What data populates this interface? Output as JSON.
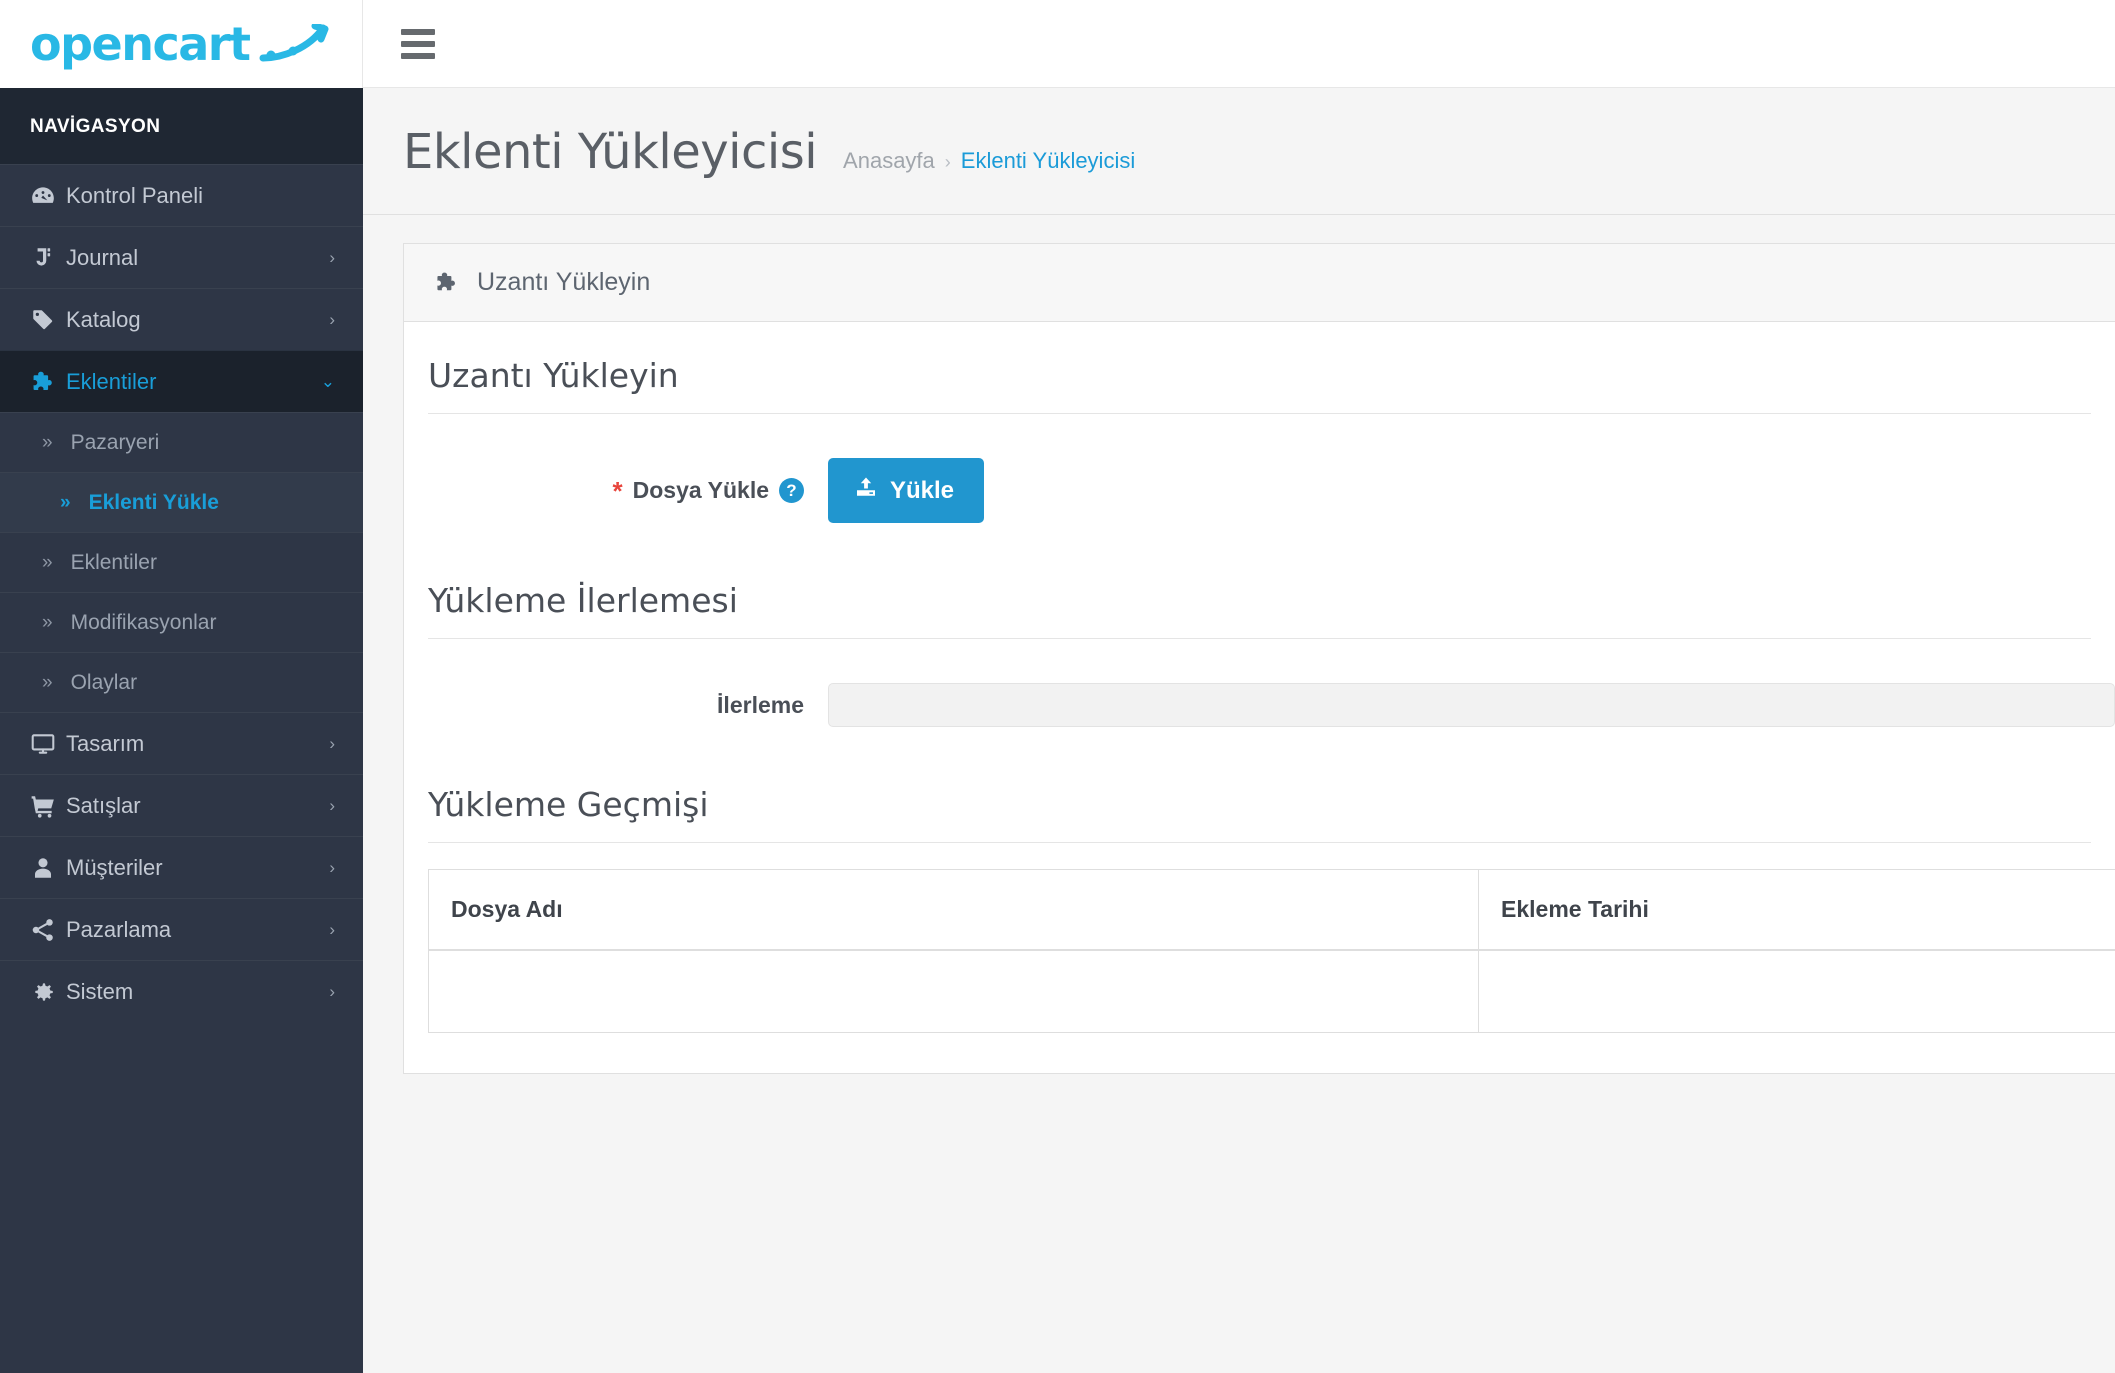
{
  "brand": {
    "logo_text": "opencart",
    "logo_color": "#29b8e5"
  },
  "sidebar": {
    "nav_header": "NAVİGASYON",
    "items": [
      {
        "label": "Kontrol Paneli",
        "icon": "dashboard-icon",
        "caret": "",
        "active": false
      },
      {
        "label": "Journal",
        "icon": "journal-icon",
        "caret": "›",
        "active": false
      },
      {
        "label": "Katalog",
        "icon": "tag-icon",
        "caret": "›",
        "active": false
      },
      {
        "label": "Eklentiler",
        "icon": "puzzle-icon",
        "caret": "⌄",
        "active": true
      }
    ],
    "sub_items": [
      {
        "label": "Pazaryeri",
        "active": false
      },
      {
        "label": "Eklenti Yükle",
        "active": true
      },
      {
        "label": "Eklentiler",
        "active": false
      },
      {
        "label": "Modifikasyonlar",
        "active": false
      },
      {
        "label": "Olaylar",
        "active": false
      }
    ],
    "items_bottom": [
      {
        "label": "Tasarım",
        "icon": "monitor-icon",
        "caret": "›"
      },
      {
        "label": "Satışlar",
        "icon": "cart-icon",
        "caret": "›"
      },
      {
        "label": "Müşteriler",
        "icon": "user-icon",
        "caret": "›"
      },
      {
        "label": "Pazarlama",
        "icon": "share-icon",
        "caret": "›"
      },
      {
        "label": "Sistem",
        "icon": "gear-icon",
        "caret": "›"
      }
    ]
  },
  "topbar": {
    "menu_toggle": "hamburger-icon"
  },
  "page": {
    "title": "Eklenti Yükleyicisi",
    "breadcrumb_home": "Anasayfa",
    "breadcrumb_sep": "›",
    "breadcrumb_current": "Eklenti Yükleyicisi"
  },
  "panel": {
    "heading": "Uzantı Yükleyin",
    "heading_icon": "puzzle-icon"
  },
  "form": {
    "legend_upload": "Uzantı Yükleyin",
    "file_label": "Dosya Yükle",
    "required_marker": "*",
    "help_icon": "question-circle-icon",
    "upload_button": "Yükle",
    "upload_button_icon": "upload-icon",
    "upload_button_color": "#2196cf"
  },
  "progress_section": {
    "legend": "Yükleme İlerlemesi",
    "label": "İlerleme",
    "value_percent": 0
  },
  "history_section": {
    "legend": "Yükleme Geçmişi",
    "columns": [
      "Dosya Adı",
      "Ekleme Tarihi"
    ],
    "rows": [
      {
        "file_name": "",
        "date_added": ""
      }
    ]
  }
}
